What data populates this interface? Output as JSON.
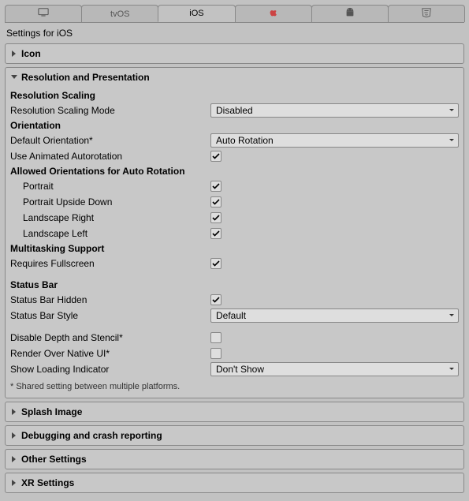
{
  "tabs": {
    "tvos_label": "tvOS",
    "ios_label": "iOS"
  },
  "title": "Settings for iOS",
  "sections": {
    "icon": {
      "title": "Icon"
    },
    "resolution": {
      "title": "Resolution and Presentation",
      "resScaling": {
        "heading": "Resolution Scaling",
        "modeLabel": "Resolution Scaling Mode",
        "modeValue": "Disabled"
      },
      "orientation": {
        "heading": "Orientation",
        "defaultLabel": "Default Orientation*",
        "defaultValue": "Auto Rotation",
        "useAnimatedLabel": "Use Animated Autorotation",
        "useAnimatedChecked": true
      },
      "allowed": {
        "heading": "Allowed Orientations for Auto Rotation",
        "portraitLabel": "Portrait",
        "portraitChecked": true,
        "portraitUpsideLabel": "Portrait Upside Down",
        "portraitUpsideChecked": true,
        "landscapeRightLabel": "Landscape Right",
        "landscapeRightChecked": true,
        "landscapeLeftLabel": "Landscape Left",
        "landscapeLeftChecked": true
      },
      "multitasking": {
        "heading": "Multitasking Support",
        "requiresFullscreenLabel": "Requires Fullscreen",
        "requiresFullscreenChecked": true
      },
      "statusBar": {
        "heading": "Status Bar",
        "hiddenLabel": "Status Bar Hidden",
        "hiddenChecked": true,
        "styleLabel": "Status Bar Style",
        "styleValue": "Default"
      },
      "misc": {
        "disableDepthLabel": "Disable Depth and Stencil*",
        "disableDepthChecked": false,
        "renderNativeLabel": "Render Over Native UI*",
        "renderNativeChecked": false,
        "loadingLabel": "Show Loading Indicator",
        "loadingValue": "Don't Show"
      },
      "footnote": "* Shared setting between multiple platforms."
    },
    "splash": {
      "title": "Splash Image"
    },
    "debugging": {
      "title": "Debugging and crash reporting"
    },
    "other": {
      "title": "Other Settings"
    },
    "xr": {
      "title": "XR Settings"
    }
  }
}
